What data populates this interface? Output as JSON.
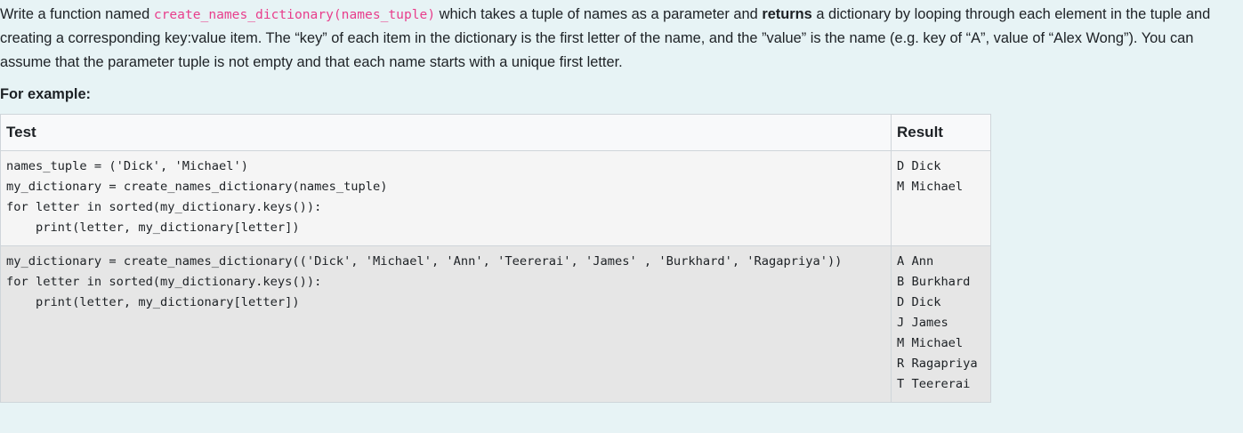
{
  "question": {
    "intro": "Write a function named ",
    "function_signature": "create_names_dictionary(names_tuple)",
    "middle_1": " which takes a tuple of names as a parameter and ",
    "bold_word": "returns",
    "rest": " a dictionary by looping through each element in the tuple and creating a corresponding key:value item. The “key” of each item in the dictionary is the first letter of the name, and the ”value” is the name (e.g. key of “A”, value of “Alex Wong”). You can assume that the parameter tuple is not empty and that each name starts with a unique first letter."
  },
  "example_heading": "For example:",
  "table": {
    "headers": {
      "test": "Test",
      "result": "Result"
    },
    "rows": [
      {
        "test": "names_tuple = ('Dick', 'Michael')\nmy_dictionary = create_names_dictionary(names_tuple)\nfor letter in sorted(my_dictionary.keys()):\n    print(letter, my_dictionary[letter])",
        "result": "D Dick\nM Michael"
      },
      {
        "test": "my_dictionary = create_names_dictionary(('Dick', 'Michael', 'Ann', 'Teererai', 'James' , 'Burkhard', 'Ragapriya'))\nfor letter in sorted(my_dictionary.keys()):\n    print(letter, my_dictionary[letter])",
        "result": "A Ann\nB Burkhard\nD Dick\nJ James\nM Michael\nR Ragapriya\nT Teererai"
      }
    ]
  },
  "colors": {
    "page_background": "#e7f3f5",
    "code_highlight": "#e83e8c",
    "row_odd": "#f5f5f5",
    "row_even": "#e6e6e6"
  }
}
